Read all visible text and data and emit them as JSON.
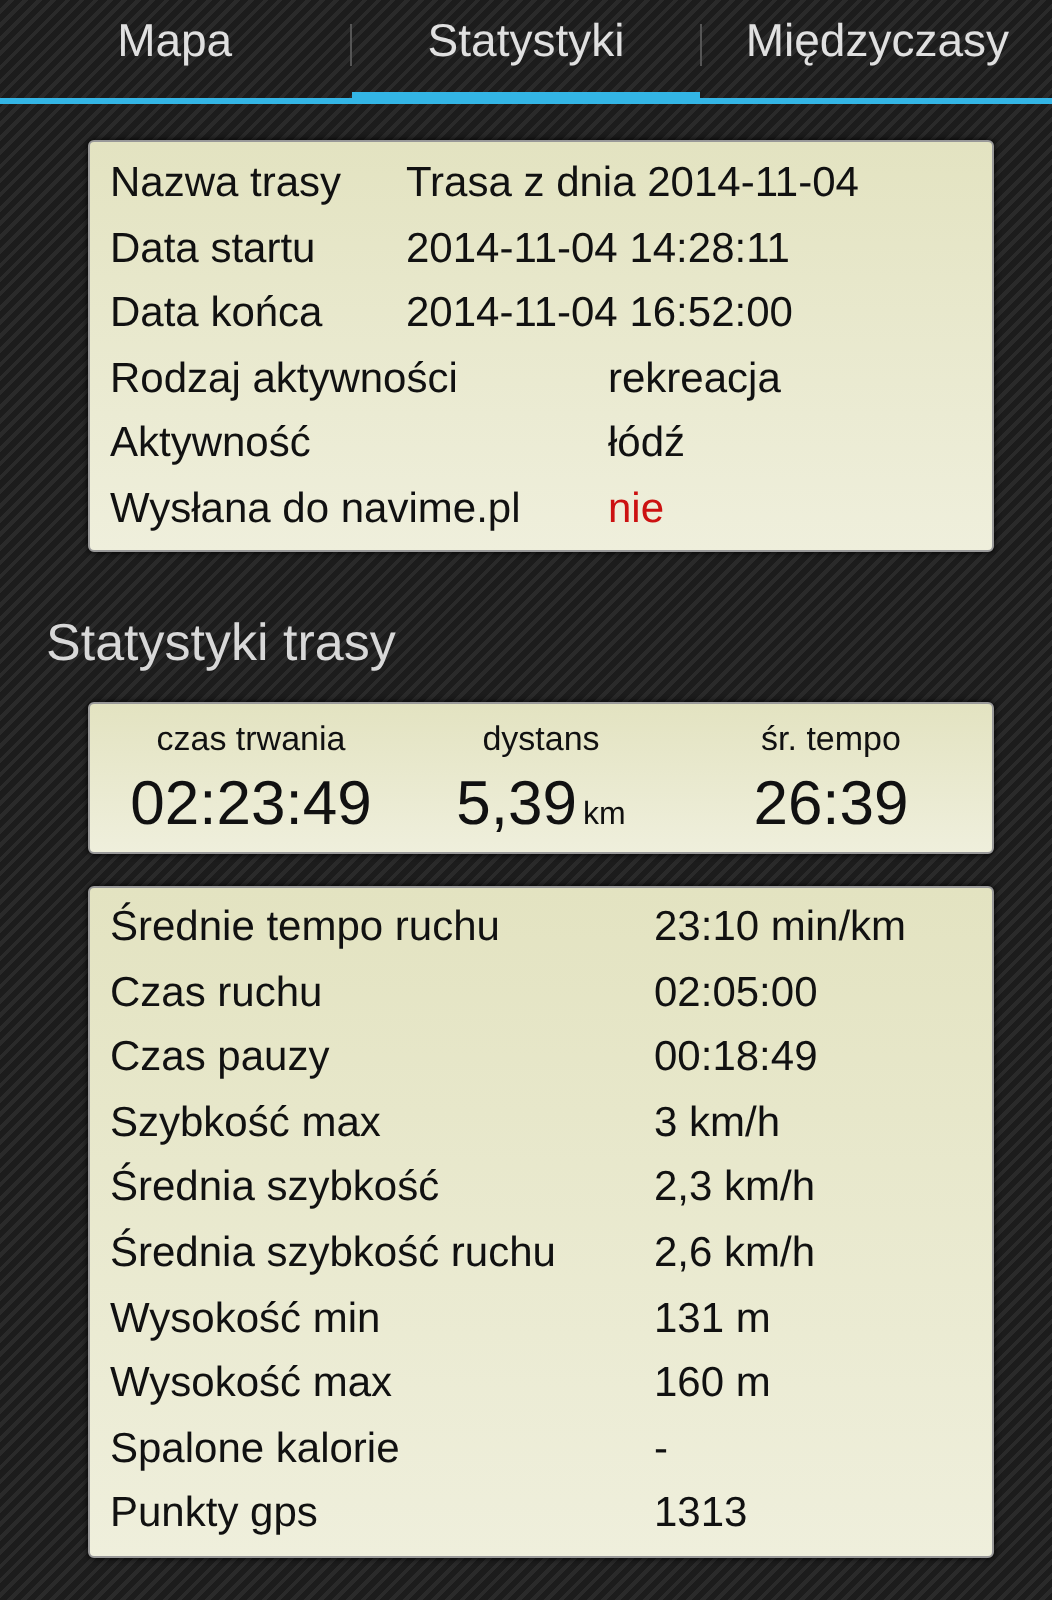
{
  "tabs": [
    {
      "label": "Mapa",
      "selected": false
    },
    {
      "label": "Statystyki",
      "selected": true
    },
    {
      "label": "Międzyczasy",
      "selected": false
    }
  ],
  "route_info": {
    "groups": [
      [
        {
          "label": "Nazwa trasy",
          "value": "Trasa z dnia 2014-11-04",
          "color": "#111111"
        },
        {
          "label": "Data startu",
          "value": "2014-11-04 14:28:11",
          "color": "#111111"
        },
        {
          "label": "Data końca",
          "value": "2014-11-04 16:52:00",
          "color": "#111111"
        }
      ],
      [
        {
          "label": "Rodzaj aktywności",
          "value": "rekreacja",
          "color": "#111111"
        },
        {
          "label": "Aktywność",
          "value": "łódź",
          "color": "#111111"
        },
        {
          "label": "Wysłana do navime.pl",
          "value": "nie",
          "color": "#cc1111"
        }
      ]
    ]
  },
  "section_title": "Statystyki trasy",
  "summary": [
    {
      "label": "czas trwania",
      "value": "02:23:49"
    },
    {
      "label": "dystans",
      "value": "5,39",
      "unit": "km"
    },
    {
      "label": "śr. tempo",
      "value": "26:39"
    }
  ],
  "stats": [
    {
      "label": "Średnie tempo ruchu",
      "value": "23:10 min/km"
    },
    {
      "label": "Czas ruchu",
      "value": "02:05:00"
    },
    {
      "label": "Czas pauzy",
      "value": "00:18:49"
    },
    {
      "label": "Szybkość max",
      "value": "3 km/h"
    },
    {
      "label": "Średnia szybkość",
      "value": "2,3 km/h"
    },
    {
      "label": "Średnia szybkość ruchu",
      "value": "2,6 km/h"
    },
    {
      "label": "Wysokość min",
      "value": "131 m"
    },
    {
      "label": "Wysokość max",
      "value": "160 m"
    },
    {
      "label": "Spalone kalorie",
      "value": "-"
    },
    {
      "label": "Punkty gps",
      "value": "1313"
    }
  ]
}
